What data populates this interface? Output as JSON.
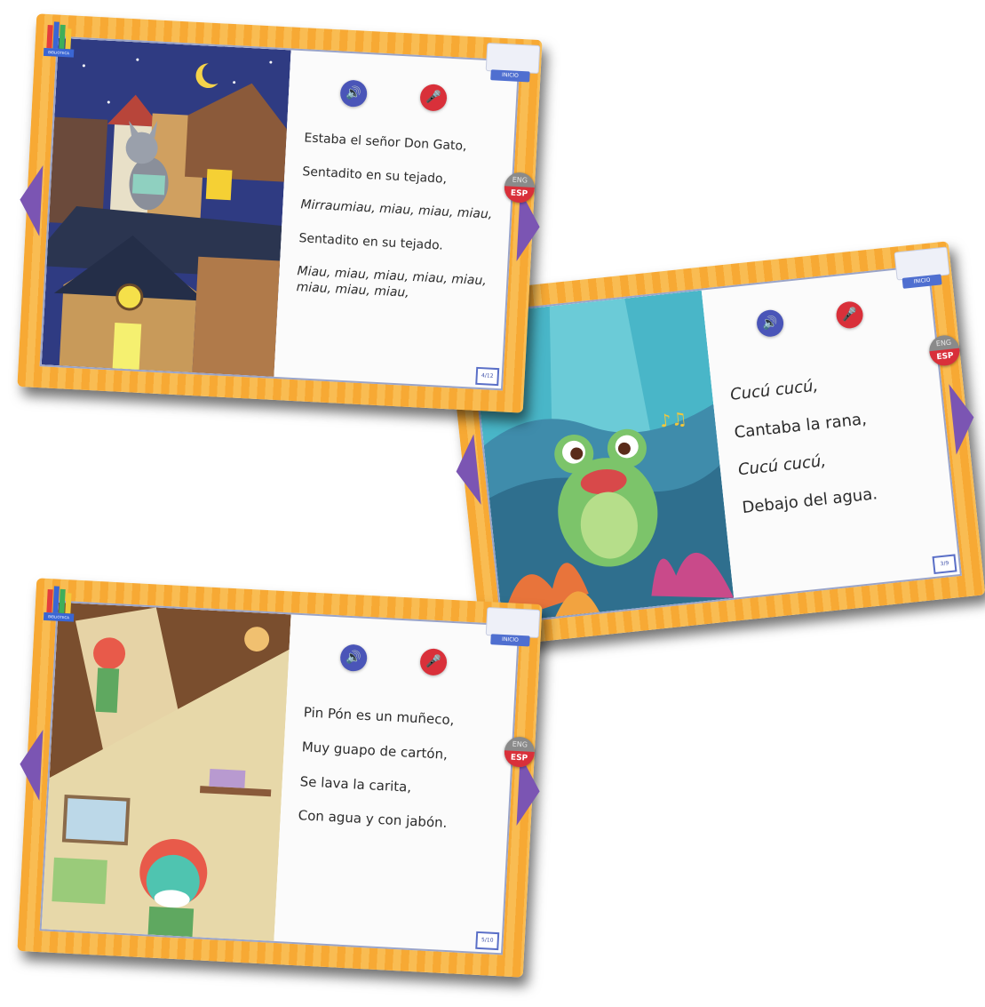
{
  "cards": [
    {
      "logo_label": "BIBLIOTECA",
      "book_label": "INICIO",
      "lang": {
        "top": "ENG",
        "bottom": "ESP"
      },
      "lines": [
        "Estaba el señor Don Gato,",
        "Sentadito en su tejado,",
        "Mirraumiau, miau, miau, miau,",
        "Sentadito en su tejado.",
        "Miau, miau, miau, miau, miau, miau, miau, miau,"
      ],
      "counter": "4/12"
    },
    {
      "book_label": "INICIO",
      "lang": {
        "top": "ENG",
        "bottom": "ESP"
      },
      "lines": [
        "Cucú cucú,",
        "Cantaba la rana,",
        "Cucú cucú,",
        "Debajo del agua."
      ],
      "counter": "3/9"
    },
    {
      "logo_label": "BIBLIOTECA",
      "book_label": "INICIO",
      "lang": {
        "top": "ENG",
        "bottom": "ESP"
      },
      "lines": [
        "Pin Pón es un muñeco,",
        "Muy guapo de cartón,",
        "Se lava la carita,",
        "Con agua y con jabón."
      ],
      "counter": "5/10"
    }
  ],
  "icons": {
    "audio": "speaker-icon",
    "mic": "microphone-icon",
    "prev": "arrow-left-icon",
    "next": "arrow-right-icon",
    "home": "open-book-icon"
  },
  "colors": {
    "frame": "#f7a934",
    "nav": "#7b55b3",
    "audio_button": "#4a55b8",
    "mic_button": "#d9303a"
  }
}
